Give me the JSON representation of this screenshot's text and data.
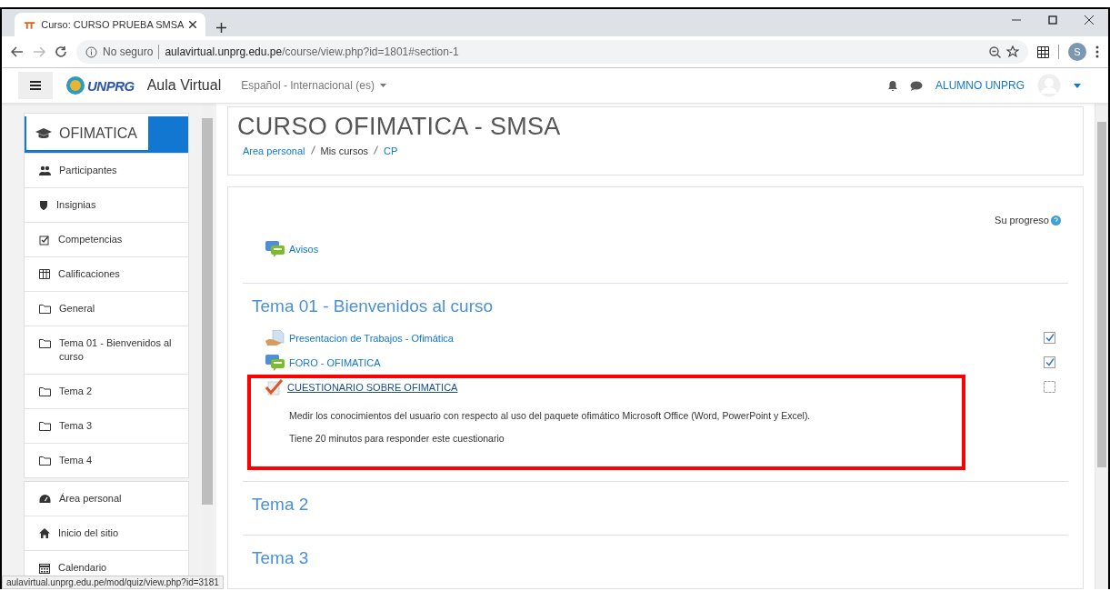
{
  "browser": {
    "tab_title": "Curso: CURSO PRUEBA SMSA",
    "security": "No seguro",
    "url_host": "aulavirtual.unprg.edu.pe",
    "url_path": "/course/view.php?id=1801#section-1",
    "profile_initial": "S",
    "status_url": "aulavirtual.unprg.edu.pe/mod/quiz/view.php?id=3181"
  },
  "navbar": {
    "logo_text": "UNPRG",
    "site_name": "Aula Virtual",
    "language": "Español - Internacional (es)",
    "user_name": "ALUMNO UNPRG"
  },
  "sidebar": {
    "course": "OFIMATICA",
    "groups": [
      {
        "items": [
          {
            "label": "Participantes",
            "kind": "users"
          },
          {
            "label": "Insignias",
            "kind": "shield"
          },
          {
            "label": "Competencias",
            "kind": "checkbox"
          },
          {
            "label": "Calificaciones",
            "kind": "table"
          },
          {
            "label": "General",
            "kind": "folder"
          },
          {
            "label": "Tema 01 - Bienvenidos al curso",
            "kind": "folder"
          },
          {
            "label": "Tema 2",
            "kind": "folder"
          },
          {
            "label": "Tema 3",
            "kind": "folder"
          },
          {
            "label": "Tema 4",
            "kind": "folder"
          }
        ]
      },
      {
        "items": [
          {
            "label": "Área personal",
            "kind": "gauge"
          },
          {
            "label": "Inicio del sitio",
            "kind": "home"
          },
          {
            "label": "Calendario",
            "kind": "calendar"
          }
        ]
      }
    ]
  },
  "course": {
    "title": "CURSO OFIMATICA - SMSA",
    "breadcrumb": [
      "Area personal",
      "Mis cursos",
      "CP"
    ],
    "progress_label": "Su progreso",
    "general": [
      {
        "kind": "forum",
        "name": "Avisos"
      }
    ],
    "sections": [
      {
        "title": "Tema 01 - Bienvenidos al curso",
        "activities": [
          {
            "kind": "assign",
            "name": "Presentacion de Trabajos - Ofimática",
            "completed": true,
            "highlighted": false
          },
          {
            "kind": "forum",
            "name": "FORO - OFIMATICA",
            "completed": true,
            "highlighted": false
          },
          {
            "kind": "quiz",
            "name": "CUESTIONARIO SOBRE OFIMATICA",
            "completed": false,
            "highlighted": true,
            "description": [
              "Medir los conocimientos del usuario con respecto al uso del paquete ofimático Microsoft Office (Word, PowerPoint y Excel).",
              "Tiene 20 minutos para responder este cuestionario"
            ]
          }
        ]
      },
      {
        "title": "Tema 2"
      },
      {
        "title": "Tema 3"
      }
    ]
  }
}
